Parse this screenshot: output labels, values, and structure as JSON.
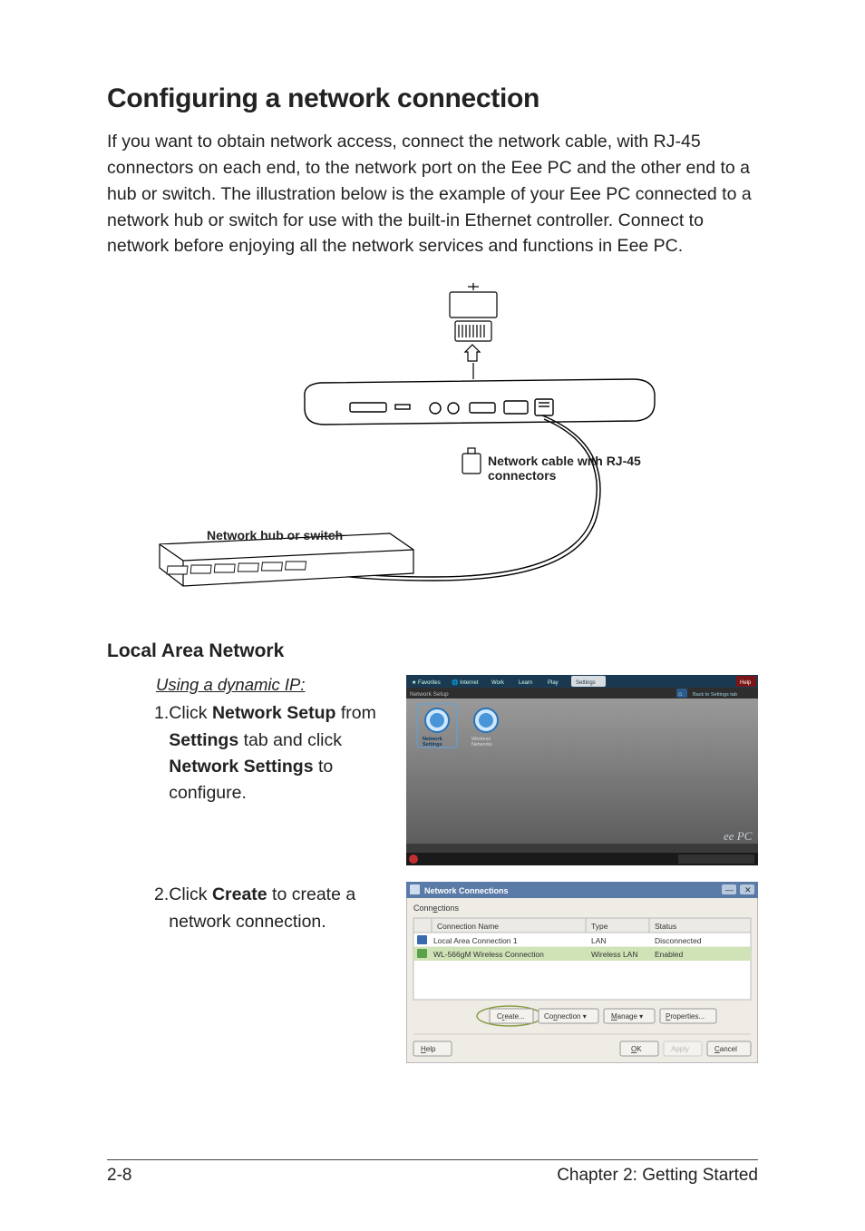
{
  "heading": "Configuring a network connection",
  "intro": "If you want to obtain network access, connect the network cable, with RJ-45 connectors on each end, to the network port on the Eee PC and the other end to a hub or switch. The illustration below is the example of your Eee PC connected to a network hub or switch for use with the built-in Ethernet controller. Connect to network before enjoying all the network services and functions in Eee PC.",
  "diagram": {
    "label_cable": "Network cable with RJ-45 connectors",
    "label_hub": "Network hub or switch",
    "brand": "ee PC"
  },
  "subheading": "Local Area Network",
  "steps_heading": "Using a dynamic IP:",
  "steps": [
    {
      "n": "1.",
      "parts": [
        {
          "t": "Click ",
          "b": false
        },
        {
          "t": "Network Setup",
          "b": true
        },
        {
          "t": " from ",
          "b": false
        },
        {
          "t": "Settings",
          "b": true
        },
        {
          "t": " tab and click ",
          "b": false
        },
        {
          "t": "Network Settings",
          "b": true
        },
        {
          "t": " to configure.",
          "b": false
        }
      ]
    },
    {
      "n": "2.",
      "parts": [
        {
          "t": "Click ",
          "b": false
        },
        {
          "t": "Create",
          "b": true
        },
        {
          "t": " to create a network connection.",
          "b": false
        }
      ]
    }
  ],
  "screenshot1": {
    "tabs": [
      "Favorites",
      "Internet",
      "Work",
      "Learn",
      "Play",
      "Settings"
    ],
    "help": "Help",
    "breadcrumb": "Network Setup",
    "back": "Back to Settings tab",
    "icons": [
      {
        "label1": "Network",
        "label2": "Settings"
      },
      {
        "label1": "Wireless",
        "label2": "Networks"
      }
    ],
    "brand": "ee PC"
  },
  "screenshot2": {
    "title": "Network Connections",
    "menu": "Connections",
    "cols": [
      "Connection Name",
      "Type",
      "Status"
    ],
    "rows": [
      {
        "name": "Local Area Connection 1",
        "type": "LAN",
        "status": "Disconnected"
      },
      {
        "name": "WL-566gM Wireless Connection",
        "type": "Wireless LAN",
        "status": "Enabled"
      }
    ],
    "buttons": {
      "create": "Create...",
      "conn": "Connection ▾",
      "manage": "Manage ▾",
      "props": "Properties..."
    },
    "footer": {
      "help": "Help",
      "ok": "OK",
      "apply": "Apply",
      "cancel": "Cancel"
    }
  },
  "page_num": "2-8",
  "chapter": "Chapter 2: Getting Started"
}
